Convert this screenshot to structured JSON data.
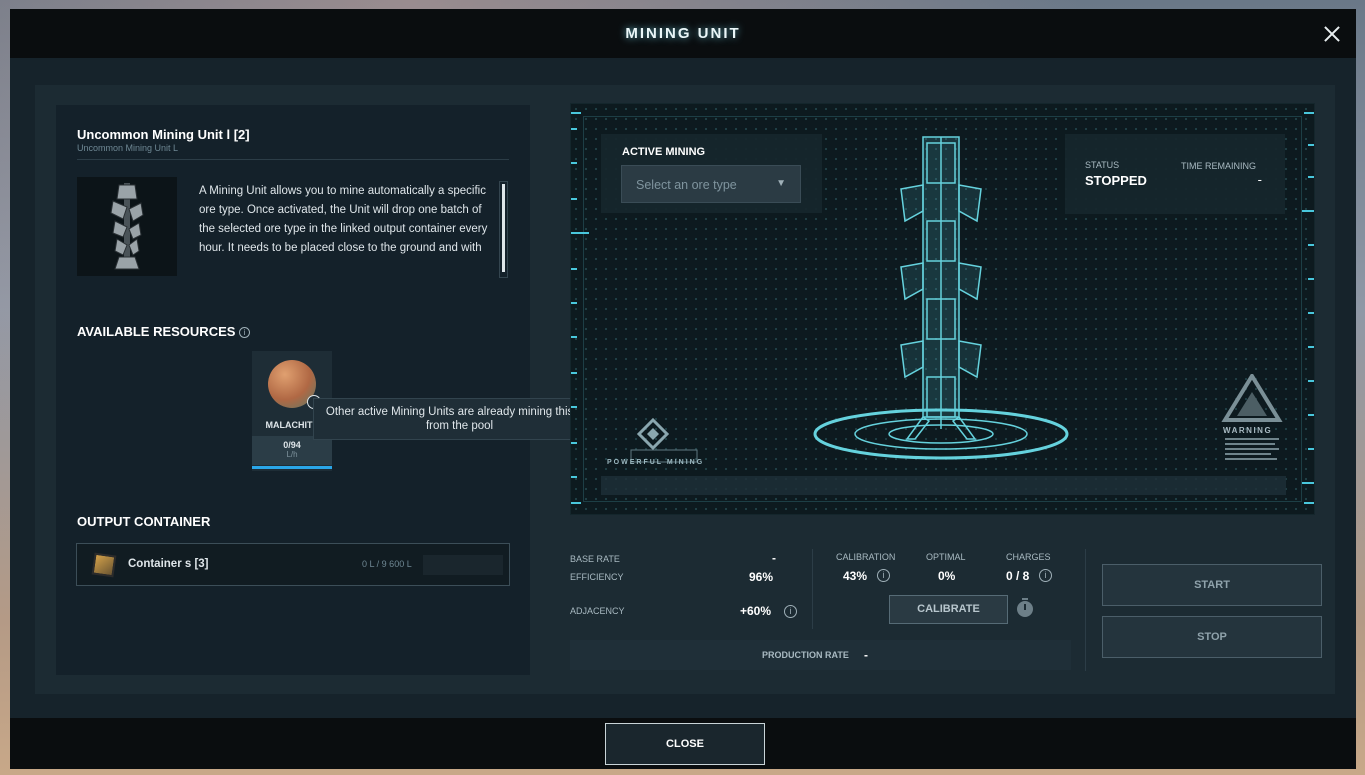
{
  "window": {
    "title": "MINING UNIT"
  },
  "unit": {
    "name": "Uncommon Mining Unit l [2]",
    "subtitle": "Uncommon Mining Unit L",
    "description": "A Mining Unit allows you to mine automatically a specific ore type. Once activated, the Unit will drop one batch of the selected ore type in the linked output container every hour. It needs to be placed close to the ground and with"
  },
  "resources": {
    "heading": "AVAILABLE RESOURCES",
    "items": [
      {
        "name": "MALACHITE",
        "amount": "0/94",
        "unit": "L/h",
        "icon": "malachite-ore-icon"
      }
    ],
    "tooltip": "Other active Mining Units are already mining this ore from the pool"
  },
  "output": {
    "heading": "OUTPUT CONTAINER",
    "container_name": "Container s [3]",
    "capacity": "0 L / 9 600 L",
    "fill_fraction": 0
  },
  "active_mining": {
    "label": "ACTIVE MINING",
    "select_placeholder": "Select an ore type"
  },
  "status": {
    "status_label": "STATUS",
    "status_value": "STOPPED",
    "time_label": "TIME REMAINING",
    "time_value": "-"
  },
  "holo": {
    "brand_text": "POWERFUL MINING",
    "warning_text": "WARNING"
  },
  "stats": {
    "base_rate_label": "BASE RATE",
    "base_rate_value": "-",
    "efficiency_label": "EFFICIENCY",
    "efficiency_value": "96%",
    "adjacency_label": "ADJACENCY",
    "adjacency_value": "+60%",
    "calibration_label": "CALIBRATION",
    "calibration_value": "43%",
    "optimal_label": "OPTIMAL",
    "optimal_value": "0%",
    "charges_label": "CHARGES",
    "charges_value": "0 / 8",
    "calibrate_button": "CALIBRATE",
    "production_rate_label": "PRODUCTION RATE",
    "production_rate_value": "-"
  },
  "controls": {
    "start": "START",
    "stop": "STOP"
  },
  "footer": {
    "close": "CLOSE"
  },
  "colors": {
    "accent": "#2aa6e8",
    "holo": "#49c7dc",
    "panel": "#14212a"
  }
}
